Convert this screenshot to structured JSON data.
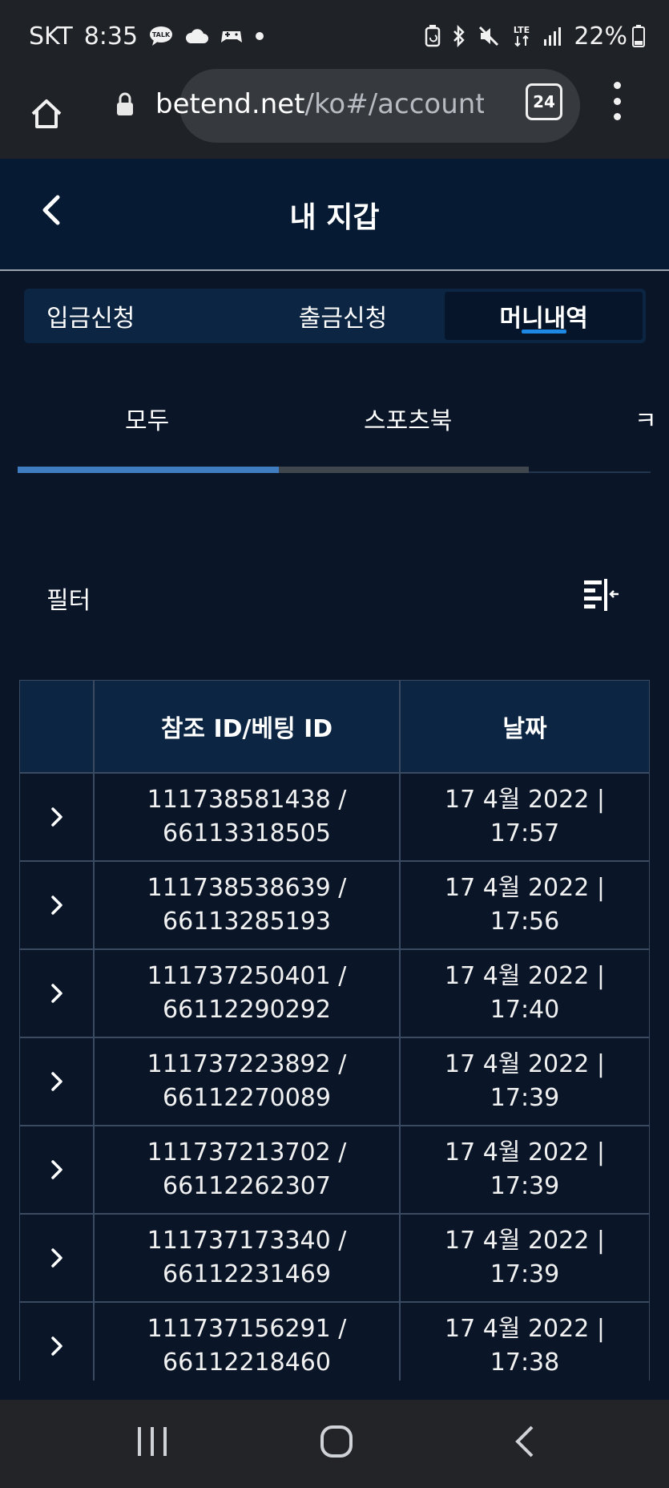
{
  "status_bar": {
    "carrier": "SKT",
    "time": "8:35",
    "talk_badge": "TALK",
    "network": "LTE",
    "battery": "22%"
  },
  "browser": {
    "url_host": "betend.net",
    "url_path": "/ko#/account",
    "tab_count": "24"
  },
  "header": {
    "title": "내 지갑"
  },
  "segments": [
    {
      "label": "입금신청",
      "active": false
    },
    {
      "label": "출금신청",
      "active": false
    },
    {
      "label": "머니내역",
      "active": true
    }
  ],
  "subtabs": [
    {
      "label": "모두"
    },
    {
      "label": "스포츠북"
    },
    {
      "label": "ㅋ"
    }
  ],
  "filter": {
    "label": "필터"
  },
  "table": {
    "headers": [
      "",
      "참조 ID/베팅 ID",
      "날짜"
    ],
    "rows": [
      {
        "ref_line1": "111738581438 /",
        "ref_line2": "66113318505",
        "date_line1": "17 4월 2022 |",
        "date_line2": "17:57"
      },
      {
        "ref_line1": "111738538639 /",
        "ref_line2": "66113285193",
        "date_line1": "17 4월 2022 |",
        "date_line2": "17:56"
      },
      {
        "ref_line1": "111737250401 /",
        "ref_line2": "66112290292",
        "date_line1": "17 4월 2022 |",
        "date_line2": "17:40"
      },
      {
        "ref_line1": "111737223892 /",
        "ref_line2": "66112270089",
        "date_line1": "17 4월 2022 |",
        "date_line2": "17:39"
      },
      {
        "ref_line1": "111737213702 /",
        "ref_line2": "66112262307",
        "date_line1": "17 4월 2022 |",
        "date_line2": "17:39"
      },
      {
        "ref_line1": "111737173340 /",
        "ref_line2": "66112231469",
        "date_line1": "17 4월 2022 |",
        "date_line2": "17:39"
      },
      {
        "ref_line1": "111737156291 /",
        "ref_line2": "66112218460",
        "date_line1": "17 4월 2022 |",
        "date_line2": "17:38"
      }
    ]
  },
  "icons": {
    "status": [
      "talk-icon",
      "cloud-icon",
      "game-icon",
      "notification-dot-icon",
      "battery-saver-icon",
      "bluetooth-icon",
      "mute-icon",
      "lte-icon",
      "signal-icon",
      "battery-icon"
    ],
    "browser": [
      "home-icon",
      "lock-icon",
      "tabs-icon",
      "more-vert-icon"
    ],
    "app": [
      "back-chevron-icon",
      "filter-collapse-icon",
      "row-expand-chevron-icon"
    ],
    "nav": [
      "recent-apps-icon",
      "home-circle-icon",
      "back-nav-icon"
    ]
  },
  "colors": {
    "page_bg": "#0a1628",
    "header_bg": "#061a33",
    "table_header_bg": "#0c2542",
    "accent": "#1e88e5",
    "subtab_active": "#3f7cc0"
  }
}
